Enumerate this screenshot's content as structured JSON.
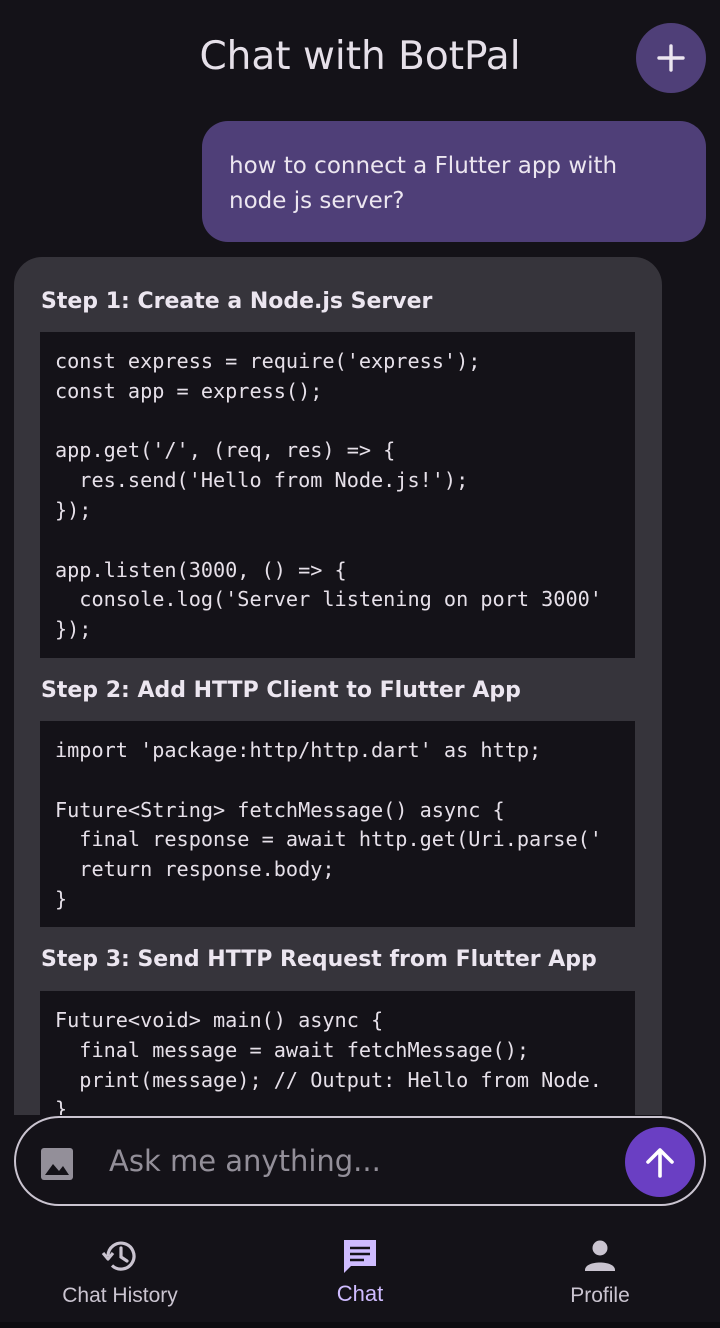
{
  "header": {
    "title": "Chat with BotPal",
    "new_chat_icon": "plus-icon"
  },
  "messages": {
    "user": "how to connect a Flutter app with node js server?",
    "bot": {
      "step1_heading": "Step 1: Create a Node.js Server",
      "step1_code": [
        "const express = require('express');",
        "const app = express();",
        "",
        "app.get('/', (req, res) => {",
        "  res.send('Hello from Node.js!');",
        "});",
        "",
        "app.listen(3000, () => {",
        "  console.log('Server listening on port 3000'",
        "});"
      ],
      "step2_heading": "Step 2: Add HTTP Client to Flutter App",
      "step2_code": [
        "import 'package:http/http.dart' as http;",
        "",
        "Future<String> fetchMessage() async {",
        "  final response = await http.get(Uri.parse('",
        "  return response.body;",
        "}"
      ],
      "step3_heading": "Step 3: Send HTTP Request from Flutter App",
      "step3_code": [
        "Future<void> main() async {",
        "  final message = await fetchMessage();",
        "  print(message); // Output: Hello from Node.",
        "}"
      ]
    }
  },
  "input": {
    "placeholder": "Ask me anything...",
    "attach_icon": "image-icon",
    "send_icon": "arrow-up-icon"
  },
  "nav": {
    "history_label": "Chat History",
    "chat_label": "Chat",
    "profile_label": "Profile",
    "active": "Chat"
  },
  "colors": {
    "background": "#141218",
    "accent": "#6a3fc3",
    "bubble_user": "#4f3f78",
    "bubble_bot": "#36343b",
    "nav_active": "#cfbcff"
  }
}
